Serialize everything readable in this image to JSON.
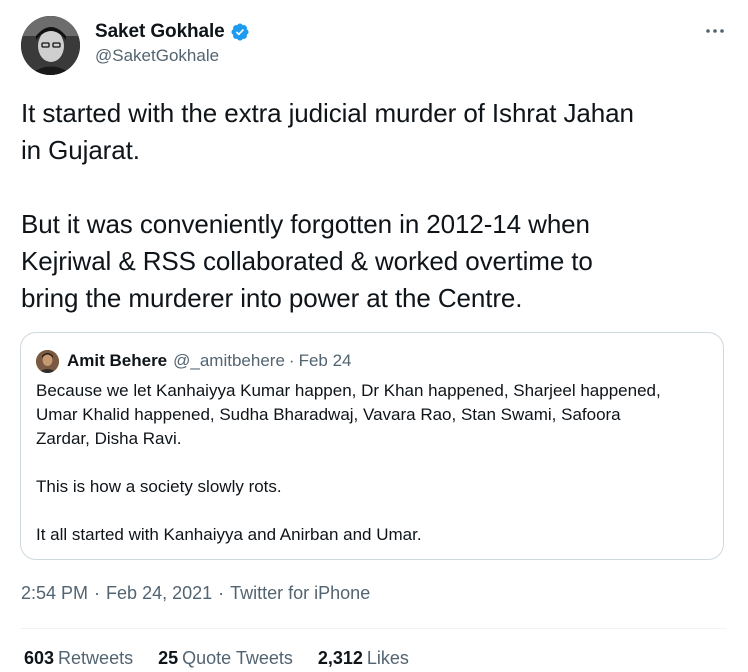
{
  "author": {
    "display_name": "Saket Gokhale",
    "handle": "@SaketGokhale",
    "verified": true
  },
  "tweet": {
    "text": "It started with the extra judicial murder of Ishrat Jahan\nin Gujarat.\n\nBut it was conveniently forgotten in 2012-14 when\nKejriwal & RSS collaborated & worked overtime to\nbring the murderer into power at the Centre."
  },
  "quoted_tweet": {
    "display_name": "Amit Behere",
    "handle": "@_amitbehere",
    "separator": "·",
    "date": "Feb 24",
    "text": "Because we let Kanhaiyya Kumar happen, Dr Khan happened, Sharjeel happened,\nUmar Khalid happened, Sudha Bharadwaj, Vavara Rao, Stan Swami, Safoora\nZardar, Disha Ravi.\n\nThis is how a society slowly rots.\n\nIt all started with Kanhaiyya and Anirban and Umar."
  },
  "meta": {
    "time": "2:54 PM",
    "separator": "·",
    "date": "Feb 24, 2021",
    "source": "Twitter for iPhone"
  },
  "stats": [
    {
      "count": "603",
      "label": "Retweets"
    },
    {
      "count": "25",
      "label": "Quote Tweets"
    },
    {
      "count": "2,312",
      "label": "Likes"
    }
  ],
  "icons": {
    "verified": "verified-badge-icon",
    "more": "more-options-icon"
  },
  "colors": {
    "text_primary": "#0f1419",
    "text_secondary": "#536471",
    "verified_blue": "#1d9bf0",
    "border": "#cfd9de"
  }
}
